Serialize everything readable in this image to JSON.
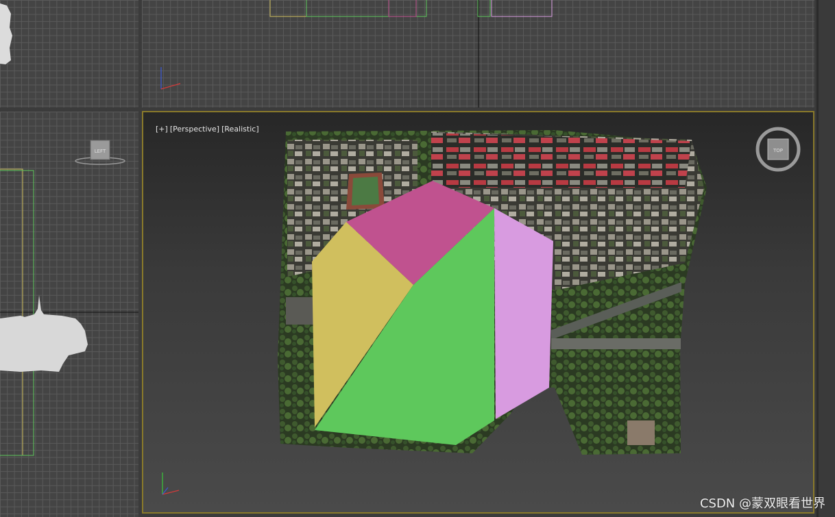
{
  "viewports": {
    "perspective": {
      "label_plus": "[+]",
      "label_view": "[Perspective]",
      "label_shading": "[Realistic]",
      "viewcube_face": "TOP"
    },
    "left": {
      "viewcube_face": "LEFT"
    }
  },
  "watermark": "CSDN @蒙双眼看世界",
  "colors": {
    "polygon_magenta": "#c0528f",
    "polygon_yellow": "#d0bf5e",
    "polygon_green": "#5ec85c",
    "polygon_pink": "#d89be0",
    "active_border": "#8a7a2a"
  }
}
